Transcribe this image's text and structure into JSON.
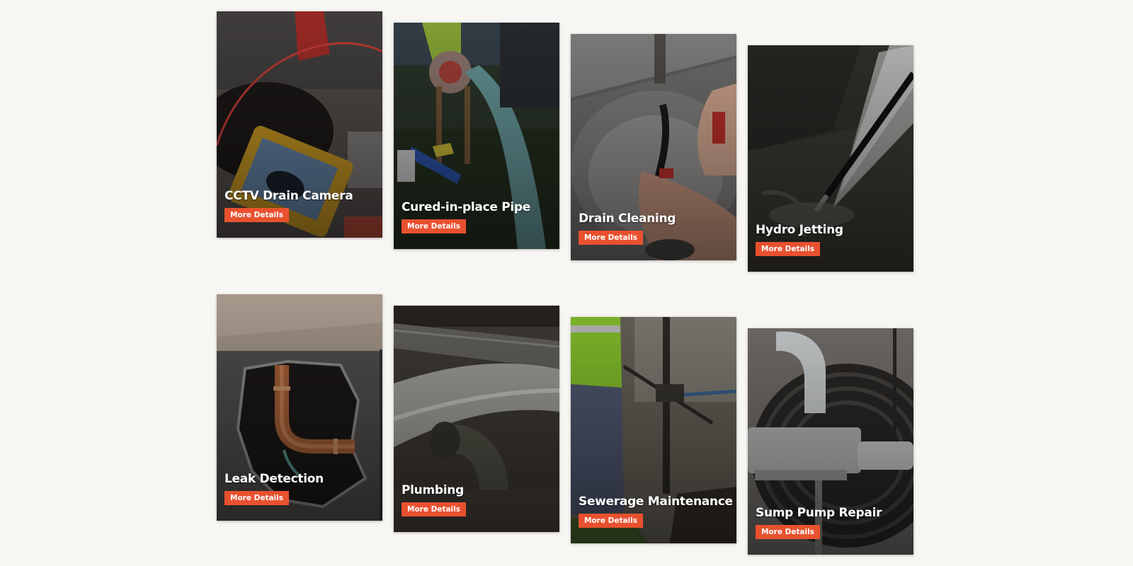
{
  "services": [
    {
      "title": "CCTV Drain Camera",
      "button": "More Details",
      "image": "cctv-drain-camera-photo"
    },
    {
      "title": "Cured-in-place Pipe",
      "button": "More Details",
      "image": "cured-in-place-pipe-photo"
    },
    {
      "title": "Drain Cleaning",
      "button": "More Details",
      "image": "drain-cleaning-photo"
    },
    {
      "title": "Hydro Jetting",
      "button": "More Details",
      "image": "hydro-jetting-photo"
    },
    {
      "title": "Leak Detection",
      "button": "More Details",
      "image": "leak-detection-photo"
    },
    {
      "title": "Plumbing",
      "button": "More Details",
      "image": "plumbing-photo"
    },
    {
      "title": "Sewerage Maintenance",
      "button": "More Details",
      "image": "sewerage-maintenance-photo"
    },
    {
      "title": "Sump Pump Repair",
      "button": "More Details",
      "image": "sump-pump-repair-photo"
    }
  ],
  "colors": {
    "background": "#f7f6f3",
    "button": "#e8512f",
    "title": "#ffffff"
  }
}
